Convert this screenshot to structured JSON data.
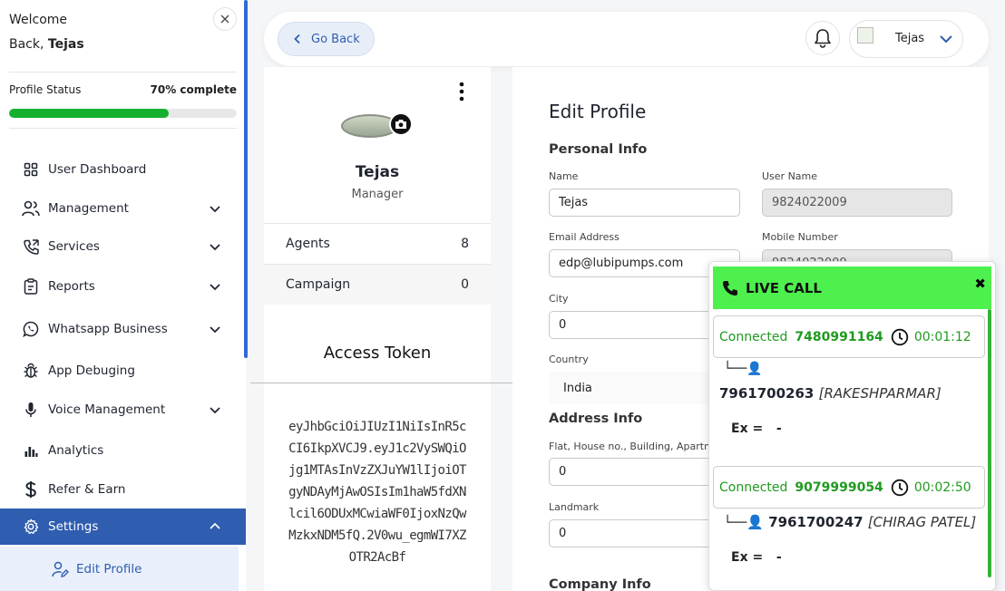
{
  "sidebar": {
    "welcome_line1": "Welcome",
    "welcome_line2_prefix": "Back,",
    "user_name": "Tejas",
    "profile_status_label": "Profile Status",
    "profile_status_value": "70% complete",
    "profile_progress": 0.7,
    "items": [
      {
        "label": "User Dashboard",
        "icon": "grid-icon",
        "has_chevron": false
      },
      {
        "label": "Management",
        "icon": "users-icon",
        "has_chevron": true
      },
      {
        "label": "Services",
        "icon": "phone-icon",
        "has_chevron": true
      },
      {
        "label": "Reports",
        "icon": "clipboard-icon",
        "has_chevron": true
      },
      {
        "label": "Whatsapp Business",
        "icon": "whatsapp-icon",
        "has_chevron": true
      },
      {
        "label": "App Debuging",
        "icon": "bug-icon",
        "has_chevron": false
      },
      {
        "label": "Voice Management",
        "icon": "microphone-icon",
        "has_chevron": true
      },
      {
        "label": "Analytics",
        "icon": "bar-chart-icon",
        "has_chevron": false
      },
      {
        "label": "Refer & Earn",
        "icon": "dollar-icon",
        "has_chevron": false
      },
      {
        "label": "Settings",
        "icon": "gear-icon",
        "has_chevron": true,
        "active": true
      }
    ],
    "sub_item": {
      "label": "Edit Profile",
      "icon": "user-edit-icon"
    },
    "accent_color": "#2f5db0",
    "progress_color": "#14b02e"
  },
  "header": {
    "back_label": "Go Back",
    "user_name": "Tejas"
  },
  "profile_card": {
    "name": "Tejas",
    "role": "Manager",
    "stats": [
      {
        "label": "Agents",
        "value": "8"
      },
      {
        "label": "Campaign",
        "value": "0"
      }
    ]
  },
  "token_card": {
    "title": "Access Token",
    "token": "eyJhbGciOiJIUzI1NiIsInR5cCI6IkpXVCJ9.eyJ1c2VySWQiOjg1MTAsInVzZXJuYW1lIjoiOTgyNDAyMjAwOSIsIm1haW5fdXNlcil6ODUxMCwiaWF0IjoxNzQwMzkxNDM5fQ.2V0wu_egmWI7XZOTR2AcBf"
  },
  "edit_profile": {
    "title": "Edit Profile",
    "personal_info_title": "Personal Info",
    "name_label": "Name",
    "name_value": "Tejas",
    "username_label": "User Name",
    "username_value": "9824022009",
    "email_label": "Email Address",
    "email_value": "edp@lubipumps.com",
    "mobile_label": "Mobile Number",
    "mobile_value": "9824022009",
    "city_label": "City",
    "city_value": "0",
    "country_label": "Country",
    "country_value": "India",
    "address_info_title": "Address Info",
    "flat_label": "Flat, House no., Building, Apartment",
    "flat_value": "0",
    "landmark_label": "Landmark",
    "landmark_value": "0",
    "company_info_title": "Company Info"
  },
  "live_call": {
    "title": "LIVE CALL",
    "close_label": "✖",
    "header_color": "#4ef04e",
    "calls": [
      {
        "status": "Connected",
        "number": "7480991164",
        "duration": "00:01:12",
        "caller_number": "7961700263",
        "caller_name": "[RAKESHPARMAR]",
        "ext_label": "Ex =",
        "ext_value": "-"
      },
      {
        "status": "Connected",
        "number": "9079999054",
        "duration": "00:02:50",
        "caller_number": "7961700247",
        "caller_name": "[CHIRAG PATEL]",
        "ext_label": "Ex =",
        "ext_value": "-"
      }
    ]
  }
}
